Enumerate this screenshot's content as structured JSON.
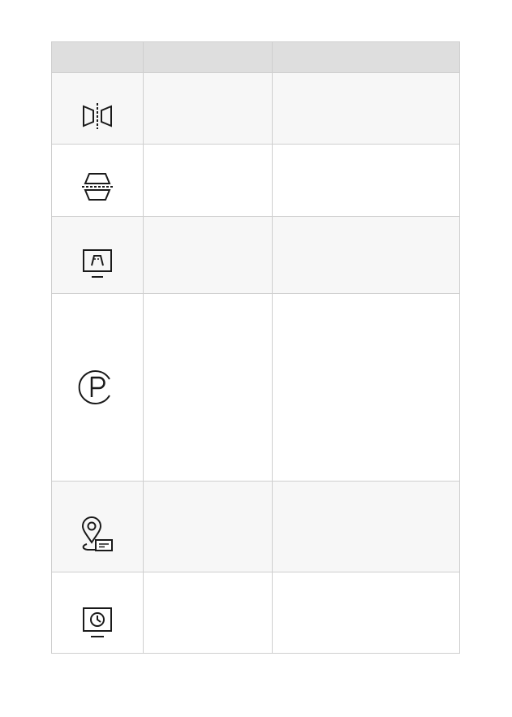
{
  "table": {
    "headers": [
      "",
      "",
      ""
    ],
    "rows": [
      {
        "icon": "mirror-flip-icon",
        "name": "",
        "description": ""
      },
      {
        "icon": "vertical-flip-icon",
        "name": "",
        "description": ""
      },
      {
        "icon": "lane-monitor-icon",
        "name": "",
        "description": ""
      },
      {
        "icon": "parking-p-icon",
        "name": "",
        "description": ""
      },
      {
        "icon": "location-pin-message-icon",
        "name": "",
        "description": ""
      },
      {
        "icon": "clock-monitor-icon",
        "name": "",
        "description": ""
      }
    ]
  }
}
